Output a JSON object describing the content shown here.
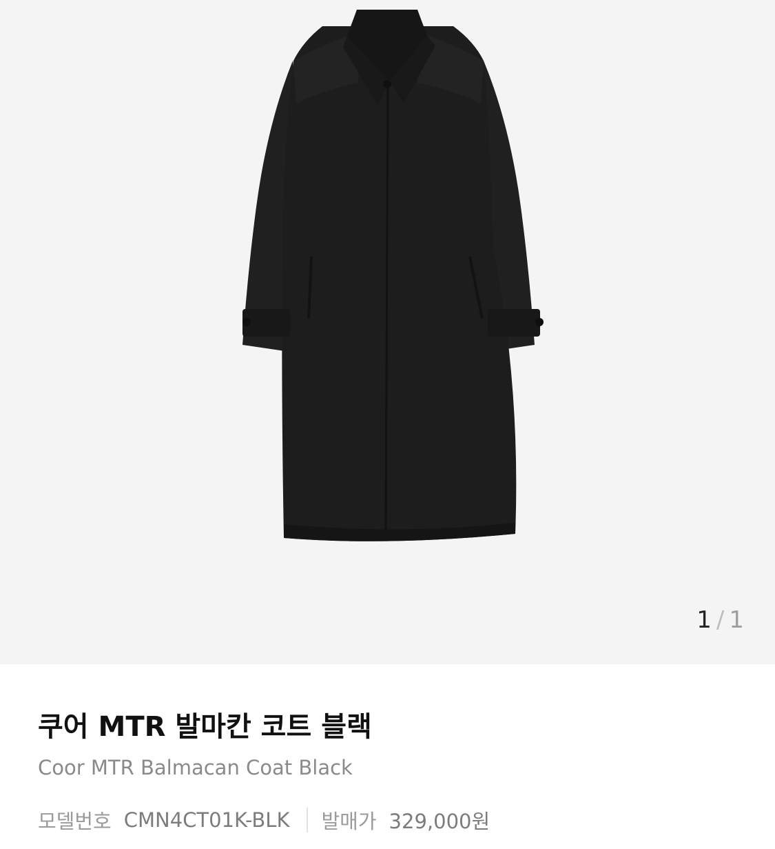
{
  "gallery": {
    "current_page": "1",
    "separator": "/",
    "total_pages": "1",
    "background": "#f4f4f4",
    "product_color": "#1c1c1c"
  },
  "product": {
    "name_ko": "쿠어 MTR 발마칸 코트 블랙",
    "name_en": "Coor MTR Balmacan Coat Black",
    "model_label": "모델번호",
    "model_value": "CMN4CT01K-BLK",
    "price_label": "발매가",
    "price_value": "329,000원"
  }
}
